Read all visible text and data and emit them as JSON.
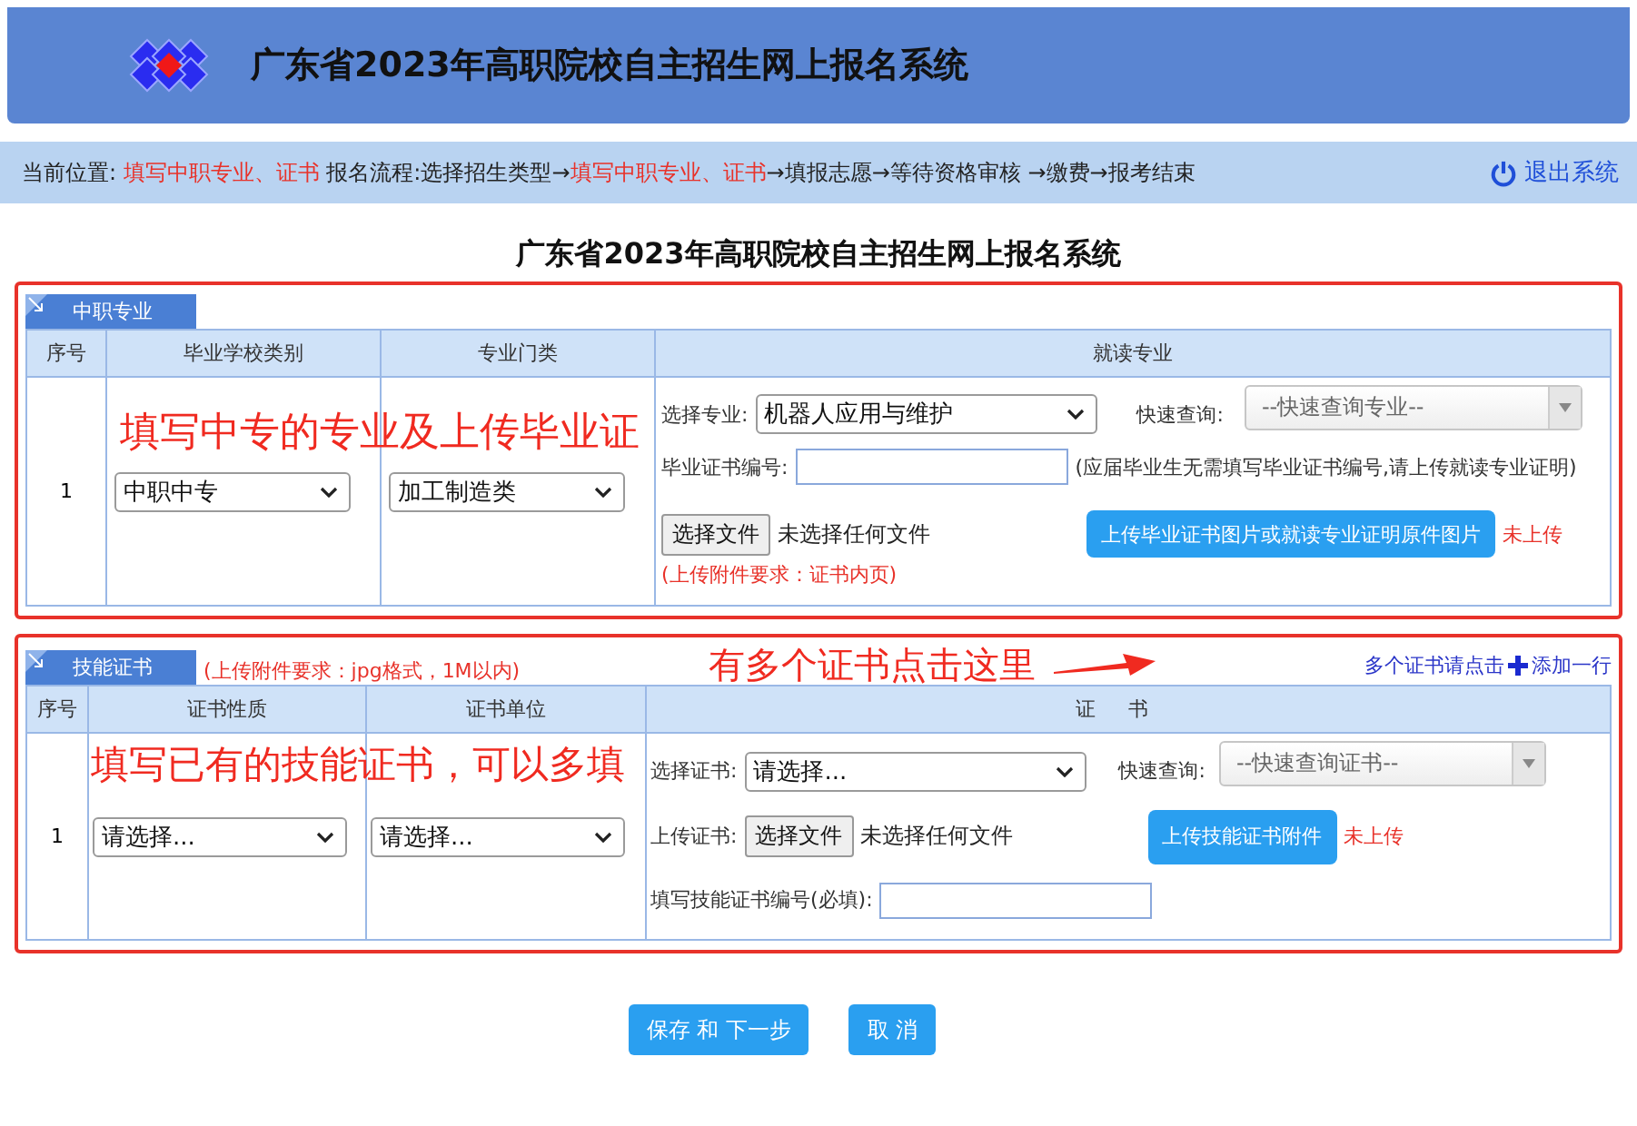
{
  "header": {
    "title": "广东省2023年高职院校自主招生网上报名系统"
  },
  "breadcrumb": {
    "flow": [
      {
        "text": "当前位置: ",
        "highlight": false
      },
      {
        "text": "填写中职专业、证书",
        "highlight": true
      },
      {
        "text": " 报名流程:选择招生类型→",
        "highlight": false
      },
      {
        "text": "填写中职专业、证书",
        "highlight": true
      },
      {
        "text": "→填报志愿→等待资格审核 →缴费→报考结束",
        "highlight": false
      }
    ],
    "logout": "退出系统"
  },
  "page_title": "广东省2023年高职院校自主招生网上报名系统",
  "major_section": {
    "tab": "中职专业",
    "annotation": "填写中专的专业及上传毕业证",
    "columns": [
      "序号",
      "毕业学校类别",
      "专业门类",
      "就读专业"
    ],
    "row": {
      "index": "1",
      "school_type": "中职中专",
      "category": "加工制造类",
      "major_label": "选择专业:",
      "major": "机器人应用与维护",
      "search_label": "快速查询:",
      "search_placeholder": "--快速查询专业--",
      "cert_no_label": "毕业证书编号:",
      "cert_no_note": "(应届毕业生无需填写毕业证书编号,请上传就读专业证明)",
      "file_button": "选择文件",
      "file_status": "未选择任何文件",
      "upload_button": "上传毕业证书图片或就读专业证明原件图片",
      "upload_status": "未上传",
      "requirement": "(上传附件要求：证书内页)"
    }
  },
  "skill_section": {
    "tab": "技能证书",
    "note": "(上传附件要求：jpg格式，1M以内)",
    "annotation": "有多个证书点击这里",
    "add_prefix": "多个证书请点击",
    "add_label": "添加一行",
    "row_annotation": "填写已有的技能证书，可以多填",
    "columns": [
      "序号",
      "证书性质",
      "证书单位",
      "证书"
    ],
    "row": {
      "index": "1",
      "nature": "请选择...",
      "unit": "请选择...",
      "cert_label": "选择证书:",
      "cert": "请选择...",
      "search_label": "快速查询:",
      "search_placeholder": "--快速查询证书--",
      "upload_label": "上传证书:",
      "file_button": "选择文件",
      "file_status": "未选择任何文件",
      "upload_button": "上传技能证书附件",
      "upload_status": "未上传",
      "cert_no_label": "填写技能证书编号(必填):"
    }
  },
  "buttons": [
    "保存 和 下一步",
    "取 消"
  ]
}
